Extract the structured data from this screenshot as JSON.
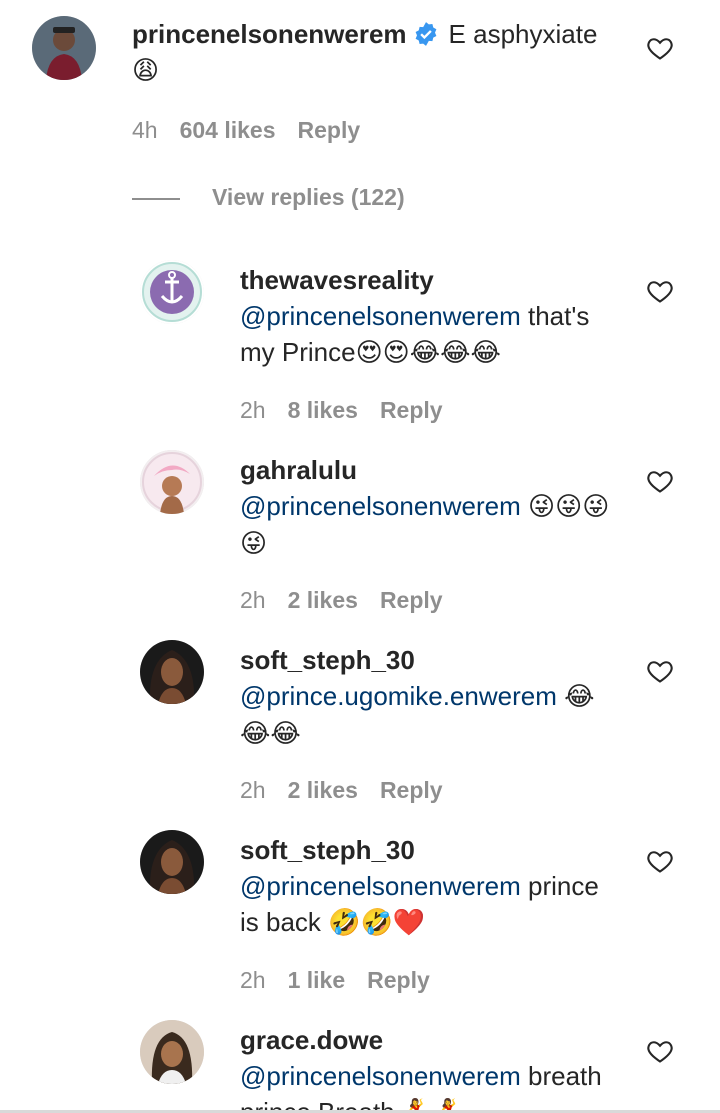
{
  "main": {
    "author": "princenelsonenwerem",
    "text": "E asphyxiate",
    "emoji": "😩",
    "time": "4h",
    "likes": "604 likes",
    "reply": "Reply"
  },
  "view_replies": "View replies (122)",
  "replies": [
    {
      "user": "thewavesreality",
      "mention": "@princenelsonenwerem",
      "text": " that's my Prince",
      "emoji": "😍😍😂😂😂",
      "time": "2h",
      "likes": "8 likes",
      "reply": "Reply"
    },
    {
      "user": "gahralulu",
      "mention": "@princenelsonenwerem",
      "text": " ",
      "emoji": "😜😜😜😜",
      "time": "2h",
      "likes": "2 likes",
      "reply": "Reply"
    },
    {
      "user": "soft_steph_30",
      "mention": "@prince.ugomike.enwerem",
      "text": " ",
      "emoji": "😂😂😂",
      "time": "2h",
      "likes": "2 likes",
      "reply": "Reply"
    },
    {
      "user": "soft_steph_30",
      "mention": "@princenelsonenwerem",
      "text": " prince is back ",
      "emoji": "🤣🤣❤️",
      "time": "2h",
      "likes": "1 like",
      "reply": "Reply"
    },
    {
      "user": "grace.dowe",
      "mention": "@princenelsonenwerem",
      "text": " breath prince Breath ",
      "emoji": "💃💃",
      "time": "",
      "likes": "",
      "reply": ""
    }
  ]
}
